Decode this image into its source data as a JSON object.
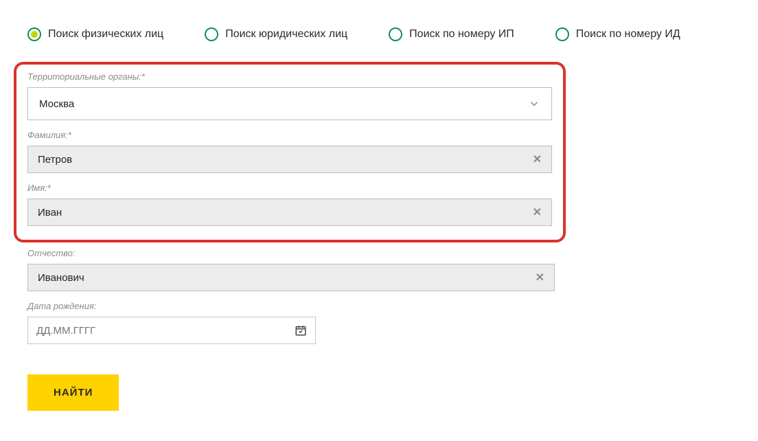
{
  "radios": [
    {
      "label": "Поиск физических лиц",
      "selected": true
    },
    {
      "label": "Поиск юридических лиц",
      "selected": false
    },
    {
      "label": "Поиск по номеру ИП",
      "selected": false
    },
    {
      "label": "Поиск по номеру ИД",
      "selected": false
    }
  ],
  "form": {
    "territory_label": "Территориальные органы:*",
    "territory_value": "Москва",
    "lastname_label": "Фамилия:*",
    "lastname_value": "Петров",
    "firstname_label": "Имя:*",
    "firstname_value": "Иван",
    "patronymic_label": "Отчество:",
    "patronymic_value": "Иванович",
    "dob_label": "Дата рождения:",
    "dob_placeholder": "ДД.ММ.ГГГГ",
    "submit_label": "НАЙТИ"
  }
}
